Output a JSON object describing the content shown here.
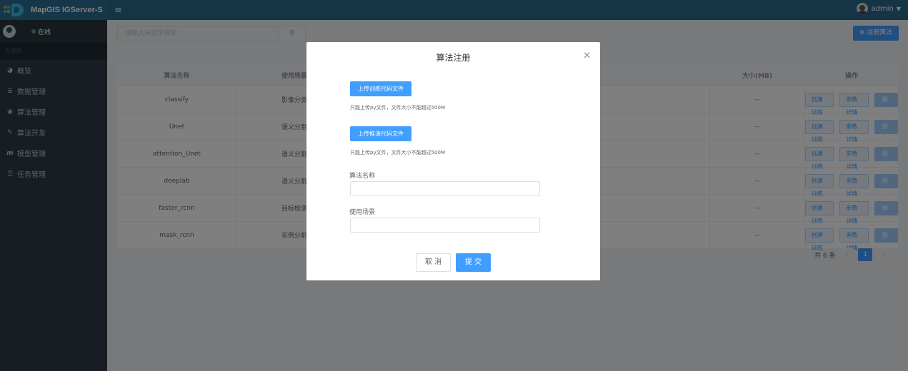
{
  "header": {
    "app_title": "MapGIS IGServer-S",
    "user": "admin"
  },
  "sidebar": {
    "status": "在线",
    "section": "主导航",
    "items": [
      {
        "label": "概览",
        "icon": "pie-chart-icon"
      },
      {
        "label": "数据管理",
        "icon": "database-icon"
      },
      {
        "label": "算法管理",
        "icon": "eye-icon"
      },
      {
        "label": "算法开发",
        "icon": "edit-icon"
      },
      {
        "label": "模型管理",
        "icon": "model-m-icon"
      },
      {
        "label": "任务管理",
        "icon": "list-icon"
      }
    ]
  },
  "main": {
    "search_placeholder": "请输入关键字搜索",
    "register_label": "⊕ 注册算法",
    "table": {
      "headers": [
        "算法名称",
        "使用场景",
        "",
        "大小(MB)",
        "操作"
      ],
      "rows": [
        {
          "name": "classify",
          "scene": "影像分类",
          "size": "--"
        },
        {
          "name": "Unet",
          "scene": "语义分割",
          "size": "--"
        },
        {
          "name": "attention_Unet",
          "scene": "语义分割",
          "size": "--"
        },
        {
          "name": "deeplab",
          "scene": "语义分割",
          "size": "--"
        },
        {
          "name": "faster_rcnn",
          "scene": "目标检测",
          "size": "--"
        },
        {
          "name": "mask_rcnn",
          "scene": "实例分割",
          "size": "--"
        }
      ],
      "actions": [
        "创建训练",
        "参数详情",
        "删除"
      ]
    },
    "pager": {
      "total": "共 6 条",
      "current": "1"
    }
  },
  "dialog": {
    "title": "算法注册",
    "upload_train": "上传训练代码文件",
    "upload_train_tip": "只能上传py文件，文件大小不能超过500M",
    "upload_infer": "上传推演代码文件",
    "upload_infer_tip": "只能上传py文件，文件大小不能超过500M",
    "name_label": "算法名称",
    "scene_label": "使用场景",
    "cancel": "取 消",
    "submit": "提 交"
  }
}
